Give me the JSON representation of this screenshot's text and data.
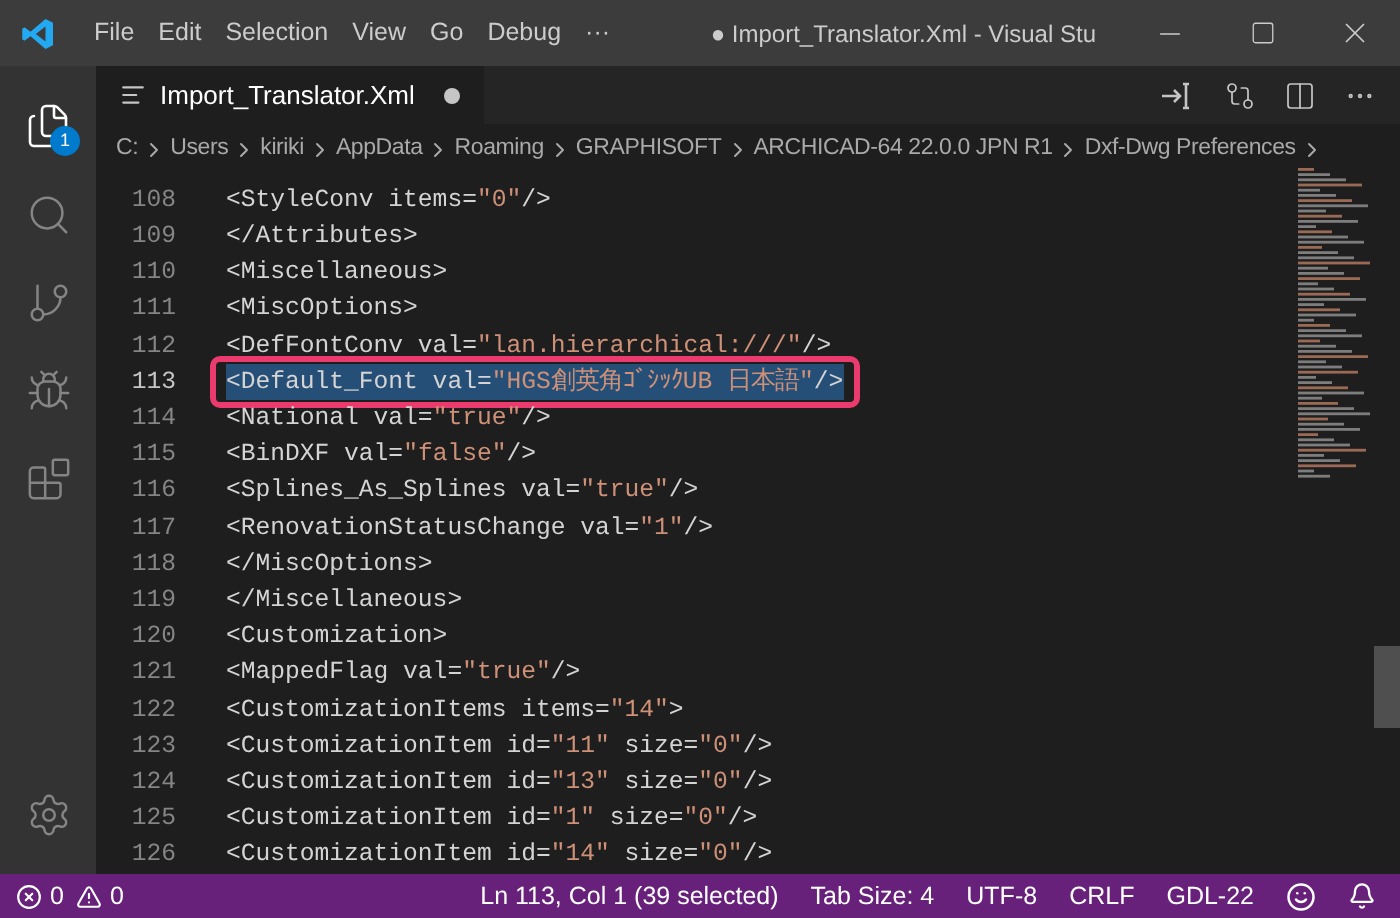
{
  "window": {
    "title": "● Import_Translator.Xml - Visual Stu"
  },
  "menu": [
    "File",
    "Edit",
    "Selection",
    "View",
    "Go",
    "Debug",
    "···"
  ],
  "activity_bar": {
    "explorer_badge": "1"
  },
  "tabs": [
    {
      "label": "Import_Translator.Xml",
      "selected": true,
      "dirty": true
    }
  ],
  "breadcrumb": [
    "C:",
    "Users",
    "kiriki",
    "AppData",
    "Roaming",
    "GRAPHISOFT",
    "ARCHICAD-64 22.0.0 JPN R1",
    "Dxf-Dwg Preferences"
  ],
  "editor": {
    "lines": [
      {
        "number": "108",
        "selected": false,
        "marked": false,
        "parts": [
          {
            "kind": "plain",
            "text": "<StyleConv items="
          },
          {
            "kind": "string",
            "text": "\"0\""
          },
          {
            "kind": "plain",
            "text": "/>"
          }
        ]
      },
      {
        "number": "109",
        "selected": false,
        "marked": false,
        "parts": [
          {
            "kind": "plain",
            "text": "</Attributes>"
          }
        ]
      },
      {
        "number": "110",
        "selected": false,
        "marked": false,
        "parts": [
          {
            "kind": "plain",
            "text": "<Miscellaneous>"
          }
        ]
      },
      {
        "number": "111",
        "selected": false,
        "marked": false,
        "parts": [
          {
            "kind": "plain",
            "text": "<MiscOptions>"
          }
        ]
      },
      {
        "number": "112",
        "selected": false,
        "marked": false,
        "parts": [
          {
            "kind": "plain",
            "text": "<DefFontConv val="
          },
          {
            "kind": "string",
            "text": "\"lan.hierarchical:///\""
          },
          {
            "kind": "plain",
            "text": "/>"
          }
        ]
      },
      {
        "number": "113",
        "selected": true,
        "marked": true,
        "parts": [
          {
            "kind": "plain",
            "text": "<Default_Font val="
          },
          {
            "kind": "string",
            "text": "\"HGS創英角ｺﾞｼｯｸUB 日本語\""
          },
          {
            "kind": "plain",
            "text": "/>"
          }
        ]
      },
      {
        "number": "114",
        "selected": false,
        "marked": false,
        "parts": [
          {
            "kind": "plain",
            "text": "<National val="
          },
          {
            "kind": "string",
            "text": "\"true\""
          },
          {
            "kind": "plain",
            "text": "/>"
          }
        ]
      },
      {
        "number": "115",
        "selected": false,
        "marked": false,
        "parts": [
          {
            "kind": "plain",
            "text": "<BinDXF val="
          },
          {
            "kind": "string",
            "text": "\"false\""
          },
          {
            "kind": "plain",
            "text": "/>"
          }
        ]
      },
      {
        "number": "116",
        "selected": false,
        "marked": false,
        "parts": [
          {
            "kind": "plain",
            "text": "<Splines_As_Splines val="
          },
          {
            "kind": "string",
            "text": "\"true\""
          },
          {
            "kind": "plain",
            "text": "/>"
          }
        ]
      },
      {
        "number": "117",
        "selected": false,
        "marked": false,
        "parts": [
          {
            "kind": "plain",
            "text": "<RenovationStatusChange val="
          },
          {
            "kind": "string",
            "text": "\"1\""
          },
          {
            "kind": "plain",
            "text": "/>"
          }
        ]
      },
      {
        "number": "118",
        "selected": false,
        "marked": false,
        "parts": [
          {
            "kind": "plain",
            "text": "</MiscOptions>"
          }
        ]
      },
      {
        "number": "119",
        "selected": false,
        "marked": false,
        "parts": [
          {
            "kind": "plain",
            "text": "</Miscellaneous>"
          }
        ]
      },
      {
        "number": "120",
        "selected": false,
        "marked": false,
        "parts": [
          {
            "kind": "plain",
            "text": "<Customization>"
          }
        ]
      },
      {
        "number": "121",
        "selected": false,
        "marked": false,
        "parts": [
          {
            "kind": "plain",
            "text": "<MappedFlag val="
          },
          {
            "kind": "string",
            "text": "\"true\""
          },
          {
            "kind": "plain",
            "text": "/>"
          }
        ]
      },
      {
        "number": "122",
        "selected": false,
        "marked": false,
        "parts": [
          {
            "kind": "plain",
            "text": "<CustomizationItems items="
          },
          {
            "kind": "string",
            "text": "\"14\""
          },
          {
            "kind": "plain",
            "text": ">"
          }
        ]
      },
      {
        "number": "123",
        "selected": false,
        "marked": false,
        "parts": [
          {
            "kind": "plain",
            "text": "<CustomizationItem id="
          },
          {
            "kind": "string",
            "text": "\"11\""
          },
          {
            "kind": "plain",
            "text": " size="
          },
          {
            "kind": "string",
            "text": "\"0\""
          },
          {
            "kind": "plain",
            "text": "/>"
          }
        ]
      },
      {
        "number": "124",
        "selected": false,
        "marked": false,
        "parts": [
          {
            "kind": "plain",
            "text": "<CustomizationItem id="
          },
          {
            "kind": "string",
            "text": "\"13\""
          },
          {
            "kind": "plain",
            "text": " size="
          },
          {
            "kind": "string",
            "text": "\"0\""
          },
          {
            "kind": "plain",
            "text": "/>"
          }
        ]
      },
      {
        "number": "125",
        "selected": false,
        "marked": false,
        "parts": [
          {
            "kind": "plain",
            "text": "<CustomizationItem id="
          },
          {
            "kind": "string",
            "text": "\"1\""
          },
          {
            "kind": "plain",
            "text": " size="
          },
          {
            "kind": "string",
            "text": "\"0\""
          },
          {
            "kind": "plain",
            "text": "/>"
          }
        ]
      },
      {
        "number": "126",
        "selected": false,
        "marked": false,
        "parts": [
          {
            "kind": "plain",
            "text": "<CustomizationItem id="
          },
          {
            "kind": "string",
            "text": "\"14\""
          },
          {
            "kind": "plain",
            "text": " size="
          },
          {
            "kind": "string",
            "text": "\"0\""
          },
          {
            "kind": "plain",
            "text": "/>"
          }
        ]
      }
    ]
  },
  "status_bar": {
    "errors": "0",
    "warnings": "0",
    "items": [
      "Ln 113, Col 1 (39 selected)",
      "Tab Size: 4",
      "UTF-8",
      "CRLF",
      "GDL-22"
    ]
  }
}
